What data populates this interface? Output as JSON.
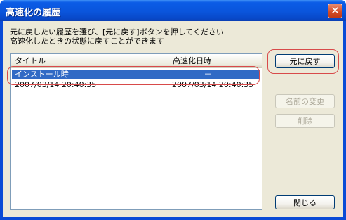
{
  "window": {
    "title": "高速化の履歴",
    "close_glyph": "✕"
  },
  "instruction": {
    "line1": "元に戻したい履歴を選び、[元に戻す]ボタンを押してください",
    "line2": "高速化したときの状態に戻すことができます"
  },
  "history_list": {
    "columns": [
      "タイトル",
      "高速化日時"
    ],
    "rows": [
      {
        "title": "インストール時",
        "datetime": "－",
        "selected": true
      },
      {
        "title": "2007/03/14 20:40:35",
        "datetime": "2007/03/14 20:40:35",
        "selected": false
      }
    ]
  },
  "buttons": {
    "restore": "元に戻す",
    "rename": "名前の変更",
    "delete": "削除",
    "close": "閉じる"
  },
  "colors": {
    "titlebar": "#0a55dc",
    "selection": "#316ac5",
    "annotation": "#d84a4a",
    "face": "#ece9d8"
  }
}
